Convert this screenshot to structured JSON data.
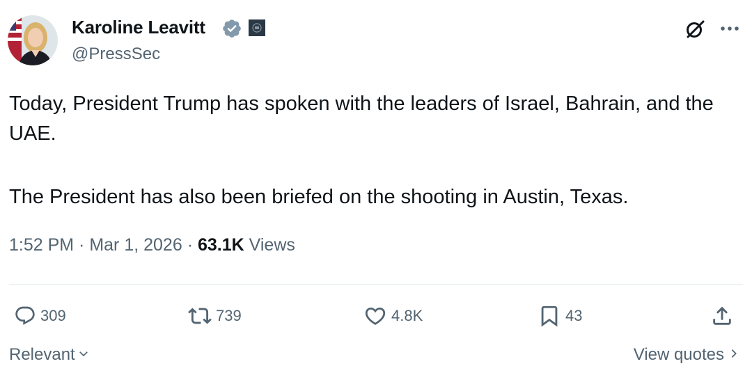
{
  "author": {
    "name": "Karoline Leavitt",
    "handle": "@PressSec",
    "avatar_icon": "avatar-photo",
    "verified_icon": "verified-badge-icon",
    "affiliation_icon": "government-affiliation-icon"
  },
  "header_actions": {
    "grok_icon": "grok-icon",
    "more_icon": "more-options-icon"
  },
  "tweet": {
    "paragraphs": [
      "Today, President Trump has spoken with the leaders of Israel, Bahrain, and the UAE.",
      "The President has also been briefed on the shooting in Austin, Texas."
    ],
    "time": "1:52 PM",
    "date": "Mar 1, 2026",
    "separator": " · ",
    "views_count": "63.1K",
    "views_label": "Views"
  },
  "actions": {
    "replies": "309",
    "retweets": "739",
    "likes": "4.8K",
    "bookmarks": "43"
  },
  "footer": {
    "relevant_label": "Relevant",
    "view_quotes_label": "View quotes"
  },
  "colors": {
    "text": "#0f1419",
    "secondary": "#536471",
    "verified_badge": "#829aab",
    "divider": "#e6ecf0"
  }
}
